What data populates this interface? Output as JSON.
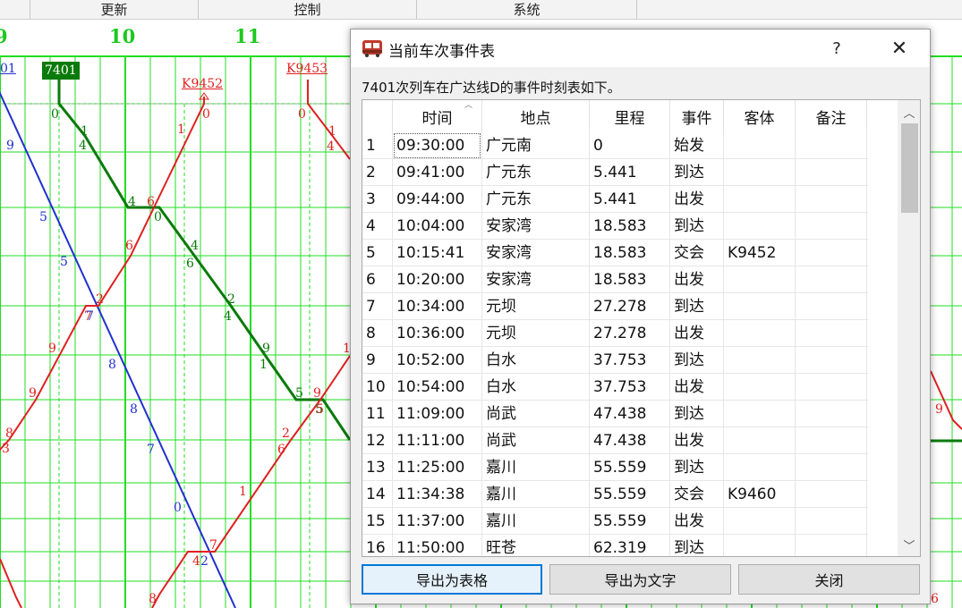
{
  "menu": {
    "items": [
      "更新",
      "控制",
      "系统"
    ]
  },
  "axis": {
    "hours": [
      "9",
      "10",
      "11"
    ]
  },
  "trains": {
    "green_id": "7401",
    "red_ids": [
      "K9452",
      "K9453"
    ],
    "blue_id": "01"
  },
  "graph_digits": {
    "green": [
      "0",
      "1",
      "4",
      "4",
      "0",
      "4",
      "6",
      "2",
      "4",
      "9",
      "1",
      "5",
      "5"
    ],
    "red": [
      "0",
      "1",
      "0",
      "1",
      "4",
      "6",
      "6",
      "2",
      "7",
      "9",
      "9",
      "8",
      "3",
      "1",
      "9",
      "5",
      "2",
      "6",
      "1",
      "7",
      "4",
      "8",
      "9",
      "6"
    ],
    "blue": [
      "9",
      "5",
      "5",
      "7",
      "8",
      "8",
      "7",
      "0",
      "2"
    ]
  },
  "dialog": {
    "title": "当前车次事件表",
    "help_label": "?",
    "close_label": "✕",
    "caption": "7401次列车在广达线D的事件时刻表如下。",
    "table": {
      "columns": [
        "",
        "时间",
        "地点",
        "里程",
        "事件",
        "客体",
        "备注"
      ],
      "rows": [
        [
          "1",
          "09:30:00",
          "广元南",
          "0",
          "始发",
          "",
          ""
        ],
        [
          "2",
          "09:41:00",
          "广元东",
          "5.441",
          "到达",
          "",
          ""
        ],
        [
          "3",
          "09:44:00",
          "广元东",
          "5.441",
          "出发",
          "",
          ""
        ],
        [
          "4",
          "10:04:00",
          "安家湾",
          "18.583",
          "到达",
          "",
          ""
        ],
        [
          "5",
          "10:15:41",
          "安家湾",
          "18.583",
          "交会",
          "K9452",
          ""
        ],
        [
          "6",
          "10:20:00",
          "安家湾",
          "18.583",
          "出发",
          "",
          ""
        ],
        [
          "7",
          "10:34:00",
          "元坝",
          "27.278",
          "到达",
          "",
          ""
        ],
        [
          "8",
          "10:36:00",
          "元坝",
          "27.278",
          "出发",
          "",
          ""
        ],
        [
          "9",
          "10:52:00",
          "白水",
          "37.753",
          "到达",
          "",
          ""
        ],
        [
          "10",
          "10:54:00",
          "白水",
          "37.753",
          "出发",
          "",
          ""
        ],
        [
          "11",
          "11:09:00",
          "尚武",
          "47.438",
          "到达",
          "",
          ""
        ],
        [
          "12",
          "11:11:00",
          "尚武",
          "47.438",
          "出发",
          "",
          ""
        ],
        [
          "13",
          "11:25:00",
          "嘉川",
          "55.559",
          "到达",
          "",
          ""
        ],
        [
          "14",
          "11:34:38",
          "嘉川",
          "55.559",
          "交会",
          "K9460",
          ""
        ],
        [
          "15",
          "11:37:00",
          "嘉川",
          "55.559",
          "出发",
          "",
          ""
        ],
        [
          "16",
          "11:50:00",
          "旺苍",
          "62.319",
          "到达",
          "",
          ""
        ]
      ]
    },
    "buttons": {
      "export_table": "导出为表格",
      "export_text": "导出为文字",
      "close": "关闭"
    }
  },
  "colors": {
    "grid": "#22dd22",
    "train_green": "#0a7a0a",
    "train_red": "#e02020",
    "train_blue": "#2030d0",
    "accent": "#0078d7"
  }
}
